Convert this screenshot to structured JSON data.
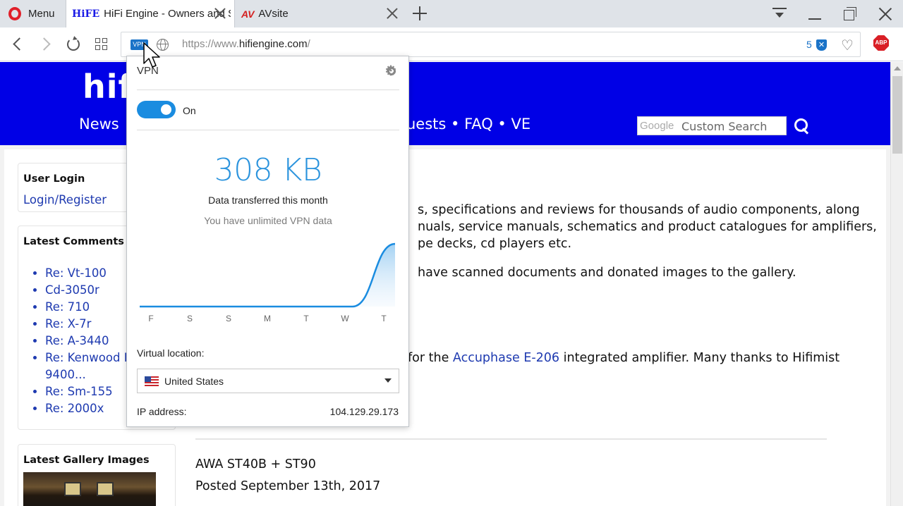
{
  "browser": {
    "menu_label": "Menu",
    "tabs": [
      {
        "favicon": "HiFE",
        "title": "HiFi Engine - Owners and Se"
      },
      {
        "favicon": "AV",
        "title": "AVsite"
      }
    ],
    "url_prefix": "https://www.",
    "url_host": "hifiengine.com",
    "url_suffix": "/",
    "adblock_count": "5",
    "vpn_badge": "VPN",
    "abp_label": "ABP"
  },
  "site": {
    "logo": "hifi",
    "nav_left": "News",
    "nav_right": "uests • FAQ • VE",
    "google_label": "Google",
    "search_placeholder": "Custom Search",
    "login": {
      "title": "User Login",
      "link": "Login/Register"
    },
    "comments": {
      "title": "Latest Comments",
      "items": [
        "Re: Vt-100",
        "Cd-3050r",
        "Re: 710",
        "Re: X-7r",
        "Re: A-3440",
        "Re: Kenwood K",
        "9400...",
        "Re: Sm-155",
        "Re: 2000x"
      ]
    },
    "gallery_title": "Latest Gallery Images",
    "intro_lines": [
      "s, specifications and reviews for thousands of audio components, along",
      "nuals, service manuals, schematics and product catalogues for amplifiers,",
      "pe decks, cd players etc.",
      "have scanned documents and donated images to the gallery."
    ],
    "news_prefix": "for the ",
    "news_link": "Accuphase E-206",
    "news_suffix": " integrated amplifier. Many thanks to Hifimist",
    "post_title": "AWA ST40B + ST90",
    "post_date": "Posted September 13th, 2017"
  },
  "vpn": {
    "title": "VPN",
    "toggle_label": "On",
    "data_amount": "308 KB",
    "data_label": "Data transferred this month",
    "unlimited_note": "You have unlimited VPN data",
    "chart_days": [
      "F",
      "S",
      "S",
      "M",
      "T",
      "W",
      "T"
    ],
    "usage_share": [
      0,
      0,
      0,
      0,
      0,
      0,
      1
    ],
    "location_label": "Virtual location:",
    "location_value": "United States",
    "ip_label": "IP address:",
    "ip_value": "104.129.29.173"
  }
}
